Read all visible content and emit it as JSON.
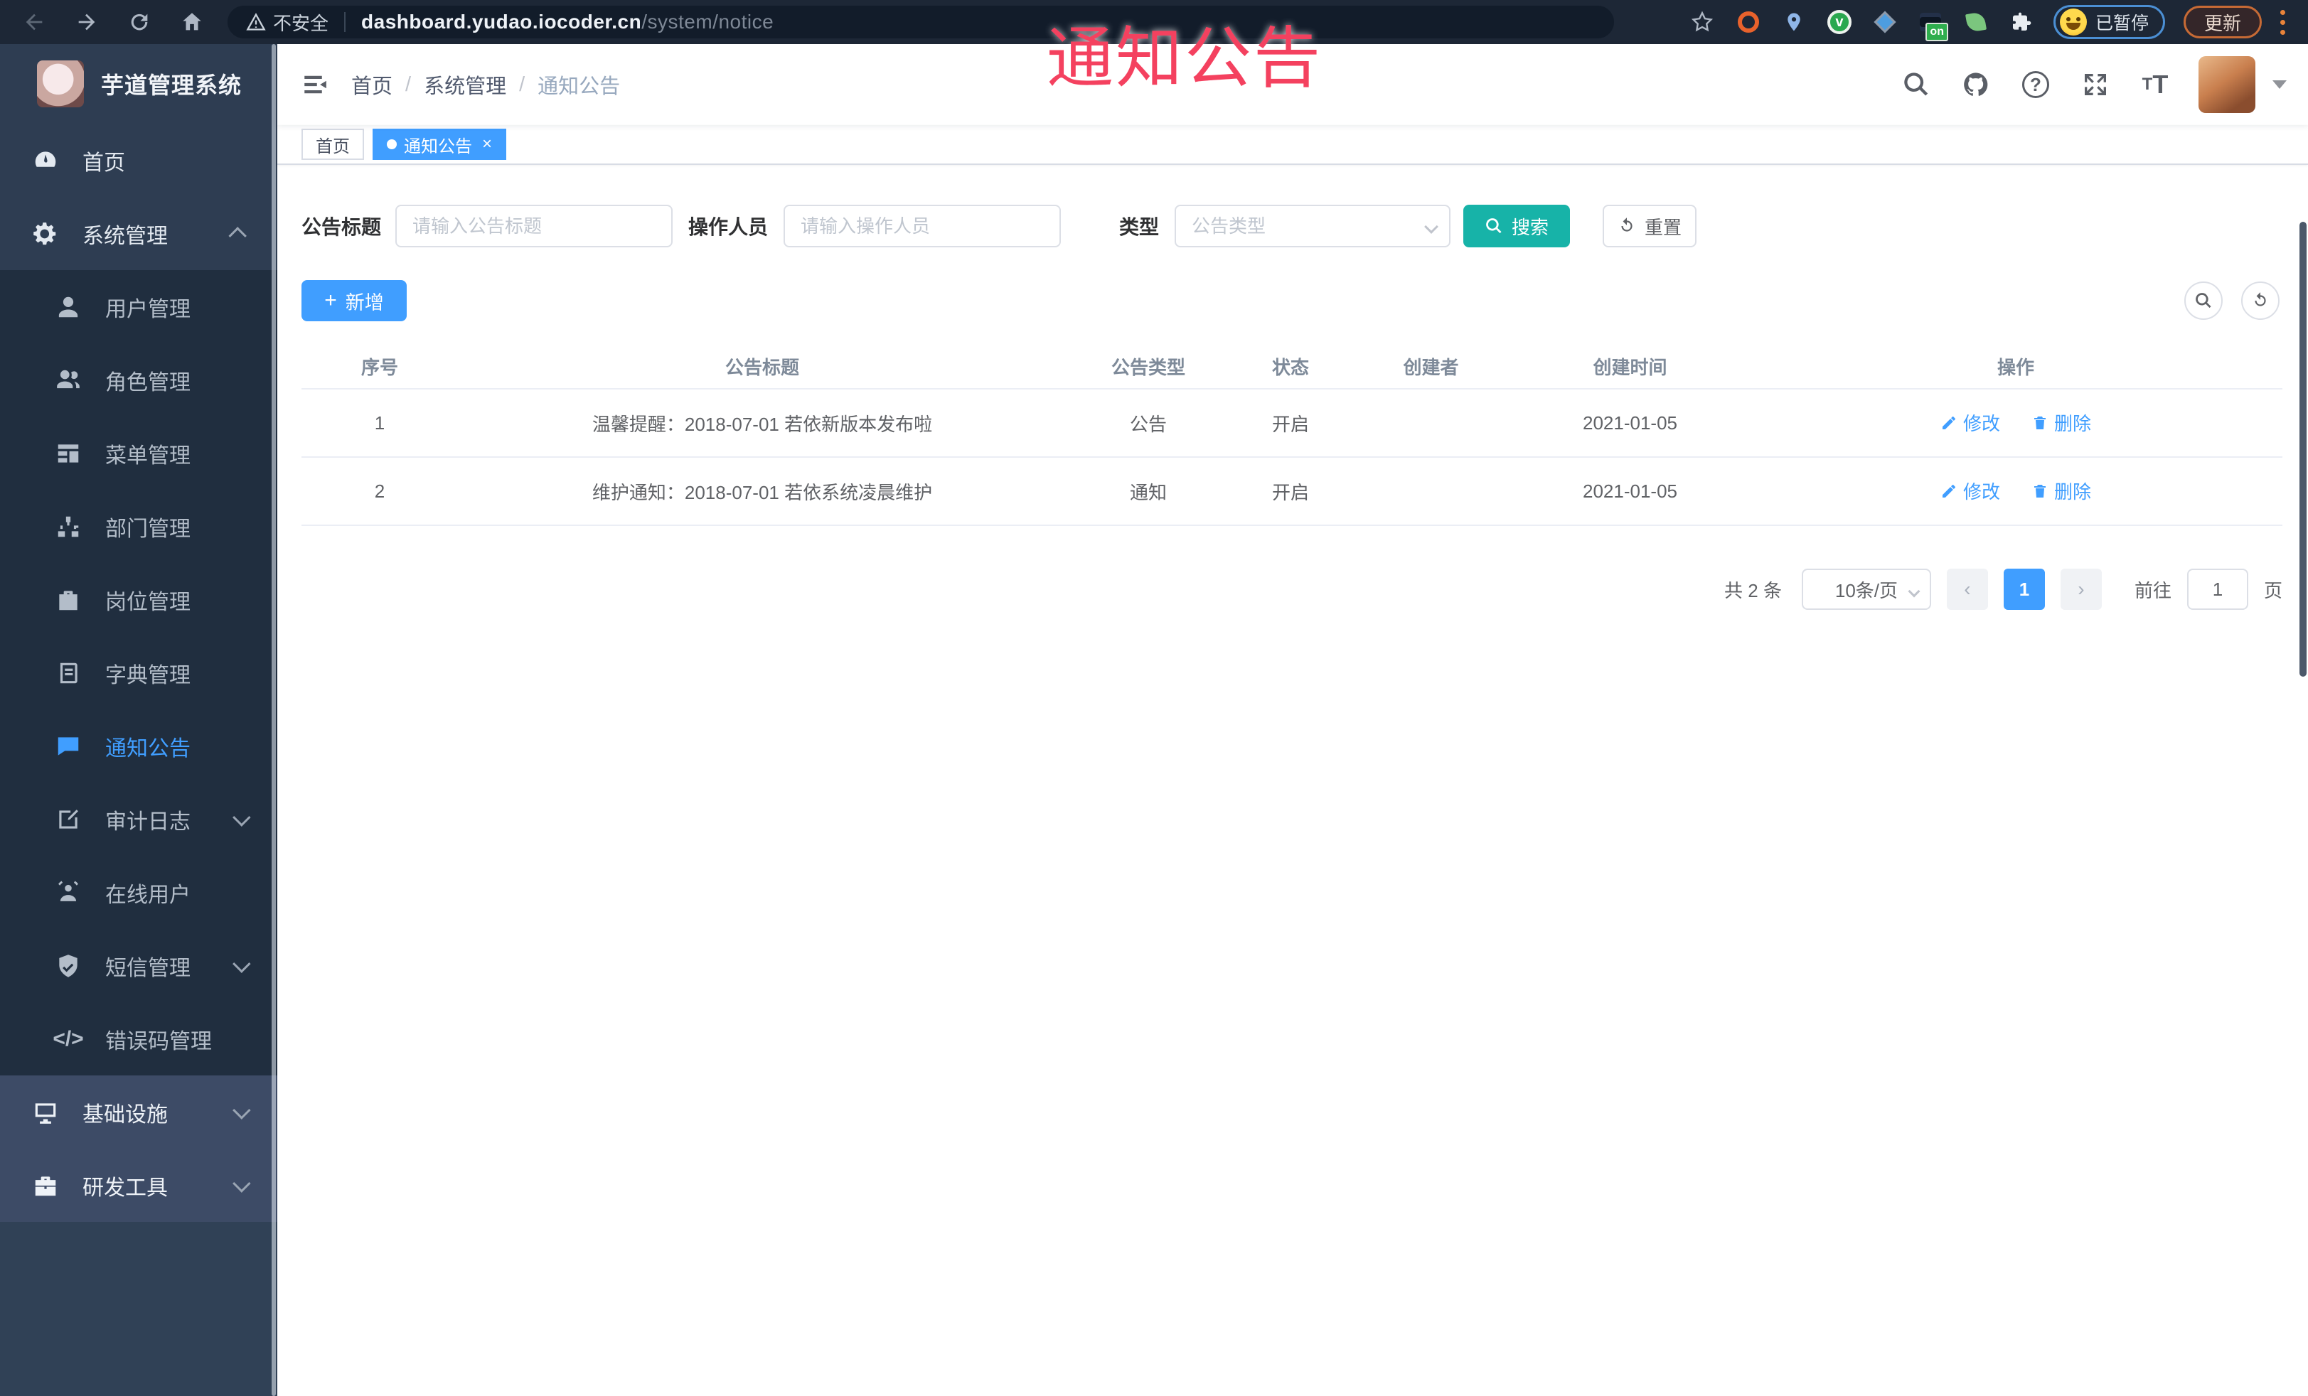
{
  "browser": {
    "security_label": "不安全",
    "url_host": "dashboard.yudao.iocoder.cn",
    "url_path": "/system/notice",
    "profile_label": "已暂停",
    "update_label": "更新",
    "extension_badge": "on"
  },
  "annotation": {
    "text": "通知公告",
    "color": "#f4415f"
  },
  "sidebar": {
    "title": "芋道管理系统",
    "items": [
      {
        "id": "home",
        "label": "首页",
        "icon": "dashboard-icon",
        "level": 1,
        "zone": "top"
      },
      {
        "id": "system",
        "label": "系统管理",
        "icon": "gear-icon",
        "level": 1,
        "zone": "top",
        "arrow": "up"
      },
      {
        "id": "user",
        "label": "用户管理",
        "icon": "user-icon",
        "level": 2,
        "zone": "sub"
      },
      {
        "id": "role",
        "label": "角色管理",
        "icon": "peoples-icon",
        "level": 2,
        "zone": "sub"
      },
      {
        "id": "menu",
        "label": "菜单管理",
        "icon": "tree-table-icon",
        "level": 2,
        "zone": "sub"
      },
      {
        "id": "dept",
        "label": "部门管理",
        "icon": "tree-icon",
        "level": 2,
        "zone": "sub"
      },
      {
        "id": "post",
        "label": "岗位管理",
        "icon": "post-icon",
        "level": 2,
        "zone": "sub"
      },
      {
        "id": "dict",
        "label": "字典管理",
        "icon": "dict-icon",
        "level": 2,
        "zone": "sub"
      },
      {
        "id": "notice",
        "label": "通知公告",
        "icon": "message-icon",
        "level": 2,
        "zone": "sub",
        "active": true
      },
      {
        "id": "audit-log",
        "label": "审计日志",
        "icon": "log-icon",
        "level": 2,
        "zone": "sub",
        "arrow": "down"
      },
      {
        "id": "online-user",
        "label": "在线用户",
        "icon": "online-icon",
        "level": 2,
        "zone": "sub"
      },
      {
        "id": "sms",
        "label": "短信管理",
        "icon": "sms-icon",
        "level": 2,
        "zone": "sub",
        "arrow": "down"
      },
      {
        "id": "error-code",
        "label": "错误码管理",
        "icon": "code-icon",
        "level": 2,
        "zone": "sub"
      },
      {
        "id": "infra",
        "label": "基础设施",
        "icon": "monitor-icon",
        "level": 1,
        "zone": "bottom",
        "arrow": "down"
      },
      {
        "id": "dev-tool",
        "label": "研发工具",
        "icon": "tool-icon",
        "level": 1,
        "zone": "bottom",
        "arrow": "down"
      }
    ]
  },
  "header": {
    "breadcrumb": [
      "首页",
      "系统管理",
      "通知公告"
    ]
  },
  "tabs": [
    {
      "label": "首页",
      "active": false
    },
    {
      "label": "通知公告",
      "active": true,
      "closable": true
    }
  ],
  "filters": {
    "title_label": "公告标题",
    "title_placeholder": "请输入公告标题",
    "operator_label": "操作人员",
    "operator_placeholder": "请输入操作人员",
    "type_label": "类型",
    "type_placeholder": "公告类型",
    "search_label": "搜索",
    "reset_label": "重置"
  },
  "toolbar": {
    "add_label": "新增"
  },
  "table": {
    "columns": [
      "序号",
      "公告标题",
      "公告类型",
      "状态",
      "创建者",
      "创建时间",
      "操作"
    ],
    "rows": [
      {
        "no": "1",
        "title": "温馨提醒：2018-07-01 若依新版本发布啦",
        "type": "公告",
        "status": "开启",
        "creator": "",
        "created": "2021-01-05"
      },
      {
        "no": "2",
        "title": "维护通知：2018-07-01 若依系统凌晨维护",
        "type": "通知",
        "status": "开启",
        "creator": "",
        "created": "2021-01-05"
      }
    ],
    "edit_label": "修改",
    "delete_label": "删除"
  },
  "pagination": {
    "total": "共 2 条",
    "page_size": "10条/页",
    "current": "1",
    "goto_label": "前往",
    "goto_value": "1",
    "page_label": "页"
  },
  "colors": {
    "accent_blue": "#409eff",
    "search_teal": "#17b3a8",
    "sidebar_bg": "#304156",
    "submenu_bg": "#202e3f",
    "sidebar_bottom_bg": "#3d4b66",
    "annotation_red": "#f4415f",
    "chrome_bg": "#1d2736"
  }
}
